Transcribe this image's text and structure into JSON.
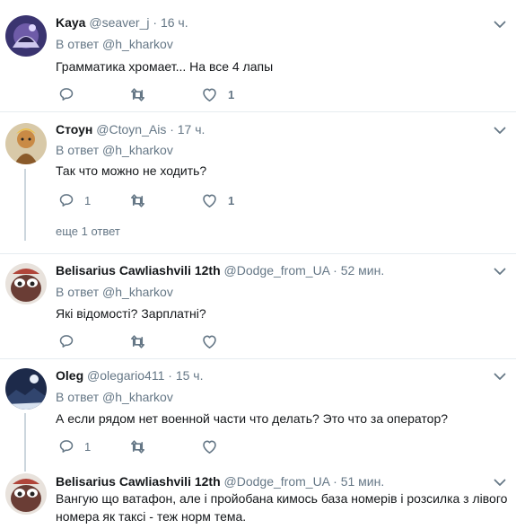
{
  "tweets": [
    {
      "name": "Kaya",
      "handle": "@seaver_j",
      "time": "· 16 ч.",
      "reply_prefix": "В ответ",
      "reply_to": "@h_kharkov",
      "text": "Грамматика хромает... На все 4 лапы",
      "replies": "",
      "retweets": "",
      "likes": "1"
    },
    {
      "name": "Стоун",
      "handle": "@Ctoyn_Ais",
      "time": "· 17 ч.",
      "reply_prefix": "В ответ",
      "reply_to": "@h_kharkov",
      "text": "Так что можно не ходить?",
      "replies": "1",
      "retweets": "",
      "likes": "1",
      "more_replies": "еще 1 ответ"
    },
    {
      "name": "Belisarius Cawliashvili 12th",
      "handle": "@Dodge_from_UA",
      "time": "· 52 мин.",
      "reply_prefix": "В ответ",
      "reply_to": "@h_kharkov",
      "text": "Які відомості? Зарплатні?",
      "replies": "",
      "retweets": "",
      "likes": ""
    },
    {
      "name": "Oleg",
      "handle": "@olegario411",
      "time": "· 15 ч.",
      "reply_prefix": "В ответ",
      "reply_to": "@h_kharkov",
      "text": "А если рядом нет военной части что делать? Это что за оператор?",
      "replies": "1",
      "retweets": "",
      "likes": ""
    },
    {
      "name": "Belisarius Cawliashvili 12th",
      "handle": "@Dodge_from_UA",
      "time": "· 51 мин.",
      "text": "Вангую що ватафон, але і пройобана кимось база номерів і розсилка з лівого номера як таксі - теж норм тема."
    }
  ],
  "colors": {
    "text": "#14171a",
    "secondary": "#657786",
    "icon": "#657786",
    "thread_line": "#ccd6dd",
    "divider": "#e6ecf0"
  },
  "icons": {
    "reply": "reply-icon",
    "retweet": "retweet-icon",
    "like": "heart-icon",
    "menu": "chevron-down-icon"
  }
}
